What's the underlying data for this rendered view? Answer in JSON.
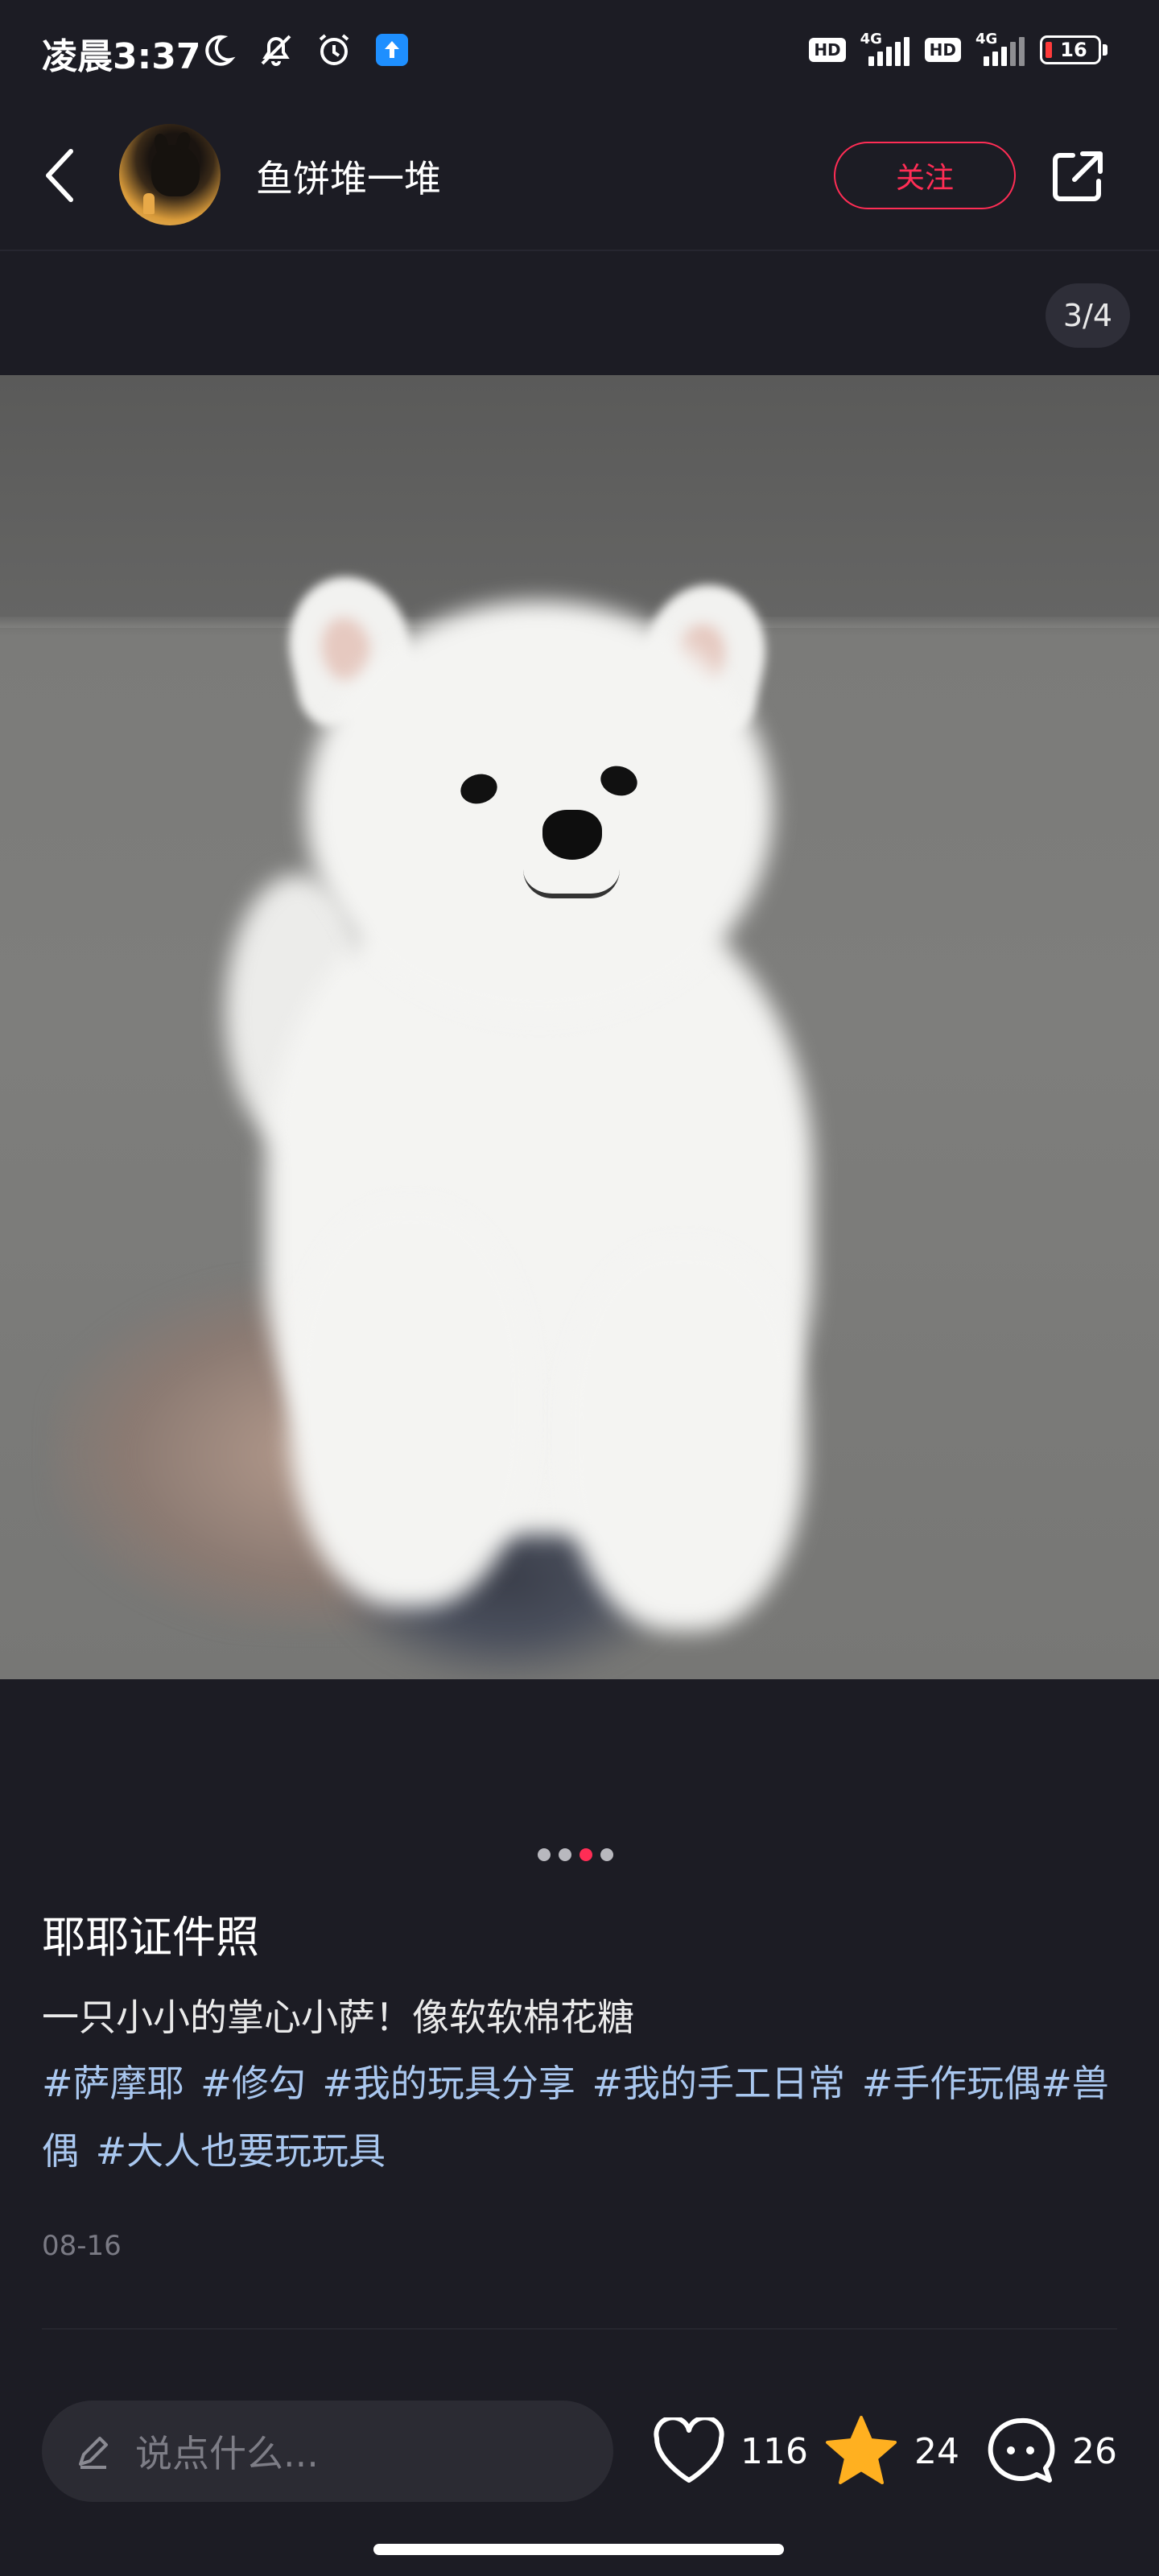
{
  "status_bar": {
    "time": "凌晨3:37",
    "hd1": "HD",
    "gen1": "4G",
    "hd2": "HD",
    "gen2": "4G",
    "battery": "16",
    "icons": [
      "moon-icon",
      "bell-off-icon",
      "alarm-icon",
      "upload-app-icon"
    ]
  },
  "header": {
    "username": "鱼饼堆一堆",
    "follow_label": "关注"
  },
  "image": {
    "counter": "3/4",
    "total": 4,
    "current": 3
  },
  "post": {
    "title": "耶耶证件照",
    "description": "一只小小的掌心小萨！像软软棉花糖",
    "tags": [
      "#萨摩耶",
      "#修勾",
      "#我的玩具分享",
      "#我的手工日常",
      "#手作玩偶#兽偶",
      "#大人也要玩玩具"
    ],
    "date": "08-16"
  },
  "bottom_bar": {
    "comment_placeholder": "说点什么...",
    "likes": "116",
    "stars": "24",
    "comments": "26"
  },
  "colors": {
    "background": "#1c1c24",
    "accent": "#ff2d55",
    "tag": "#a9c7ef",
    "star": "#ffb020"
  }
}
